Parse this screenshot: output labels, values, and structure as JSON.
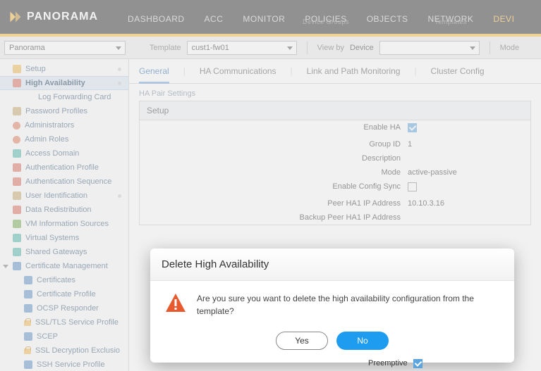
{
  "brand": "PANORAMA",
  "topnav": {
    "dashboard": "DASHBOARD",
    "acc": "ACC",
    "monitor": "MONITOR",
    "policies": "POLICIES",
    "policies_sup": "Device Groups",
    "objects": "OBJECTS",
    "network": "NETWORK",
    "network_sup": "Templates",
    "device": "DEVI"
  },
  "secondbar": {
    "context_value": "Panorama",
    "template_label": "Template",
    "template_value": "cust1-fw01",
    "viewby_label": "View by",
    "viewby_type": "Device",
    "device_value": "",
    "mode_label": "Mode"
  },
  "sidebar": {
    "items": [
      {
        "label": "Setup",
        "icon": "ic-yellow",
        "active": false,
        "dot": true
      },
      {
        "label": "High Availability",
        "icon": "ic-red",
        "active": true,
        "dot": true
      },
      {
        "label": "Log Forwarding Card",
        "icon": "",
        "active": false,
        "indent": 1
      },
      {
        "label": "Password Profiles",
        "icon": "ic-card",
        "active": false
      },
      {
        "label": "Administrators",
        "icon": "ic-red-user",
        "active": false
      },
      {
        "label": "Admin Roles",
        "icon": "ic-red-user",
        "active": false
      },
      {
        "label": "Access Domain",
        "icon": "ic-teal",
        "active": false
      },
      {
        "label": "Authentication Profile",
        "icon": "ic-red",
        "active": false
      },
      {
        "label": "Authentication Sequence",
        "icon": "ic-red",
        "active": false
      },
      {
        "label": "User Identification",
        "icon": "ic-card",
        "active": false,
        "dot": true
      },
      {
        "label": "Data Redistribution",
        "icon": "ic-red",
        "active": false
      },
      {
        "label": "VM Information Sources",
        "icon": "ic-green",
        "active": false
      },
      {
        "label": "Virtual Systems",
        "icon": "ic-teal",
        "active": false
      },
      {
        "label": "Shared Gateways",
        "icon": "ic-teal",
        "active": false
      },
      {
        "label": "Certificate Management",
        "icon": "ic-blue",
        "active": false,
        "expandable": true,
        "expanded": true
      },
      {
        "label": "Certificates",
        "icon": "ic-blue",
        "indent": 1
      },
      {
        "label": "Certificate Profile",
        "icon": "ic-blue",
        "indent": 1
      },
      {
        "label": "OCSP Responder",
        "icon": "ic-blue",
        "indent": 1
      },
      {
        "label": "SSL/TLS Service Profile",
        "icon": "ic-lock",
        "indent": 1
      },
      {
        "label": "SCEP",
        "icon": "ic-blue",
        "indent": 1
      },
      {
        "label": "SSL Decryption Exclusio",
        "icon": "ic-lock",
        "indent": 1
      },
      {
        "label": "SSH Service Profile",
        "icon": "ic-blue",
        "indent": 1
      }
    ]
  },
  "tabs": {
    "general": "General",
    "ha_comm": "HA Communications",
    "link_path": "Link and Path Monitoring",
    "cluster": "Cluster Config"
  },
  "fieldset_title": "HA Pair Settings",
  "setup": {
    "header": "Setup",
    "rows": [
      {
        "k": "Enable HA",
        "v": "",
        "check": true
      },
      {
        "k": "Group ID",
        "v": "1"
      },
      {
        "k": "Description",
        "v": ""
      },
      {
        "k": "Mode",
        "v": "active-passive"
      },
      {
        "k": "Enable Config Sync",
        "v": "",
        "check": false
      },
      {
        "k": "Peer HA1 IP Address",
        "v": "10.10.3.16"
      },
      {
        "k": "Backup Peer HA1 IP Address",
        "v": ""
      }
    ]
  },
  "modal": {
    "title": "Delete High Availability",
    "message": "Are you sure you want to delete the high availability configuration from the template?",
    "yes": "Yes",
    "no": "No"
  },
  "bottom": {
    "preemptive_label": "Preemptive"
  }
}
